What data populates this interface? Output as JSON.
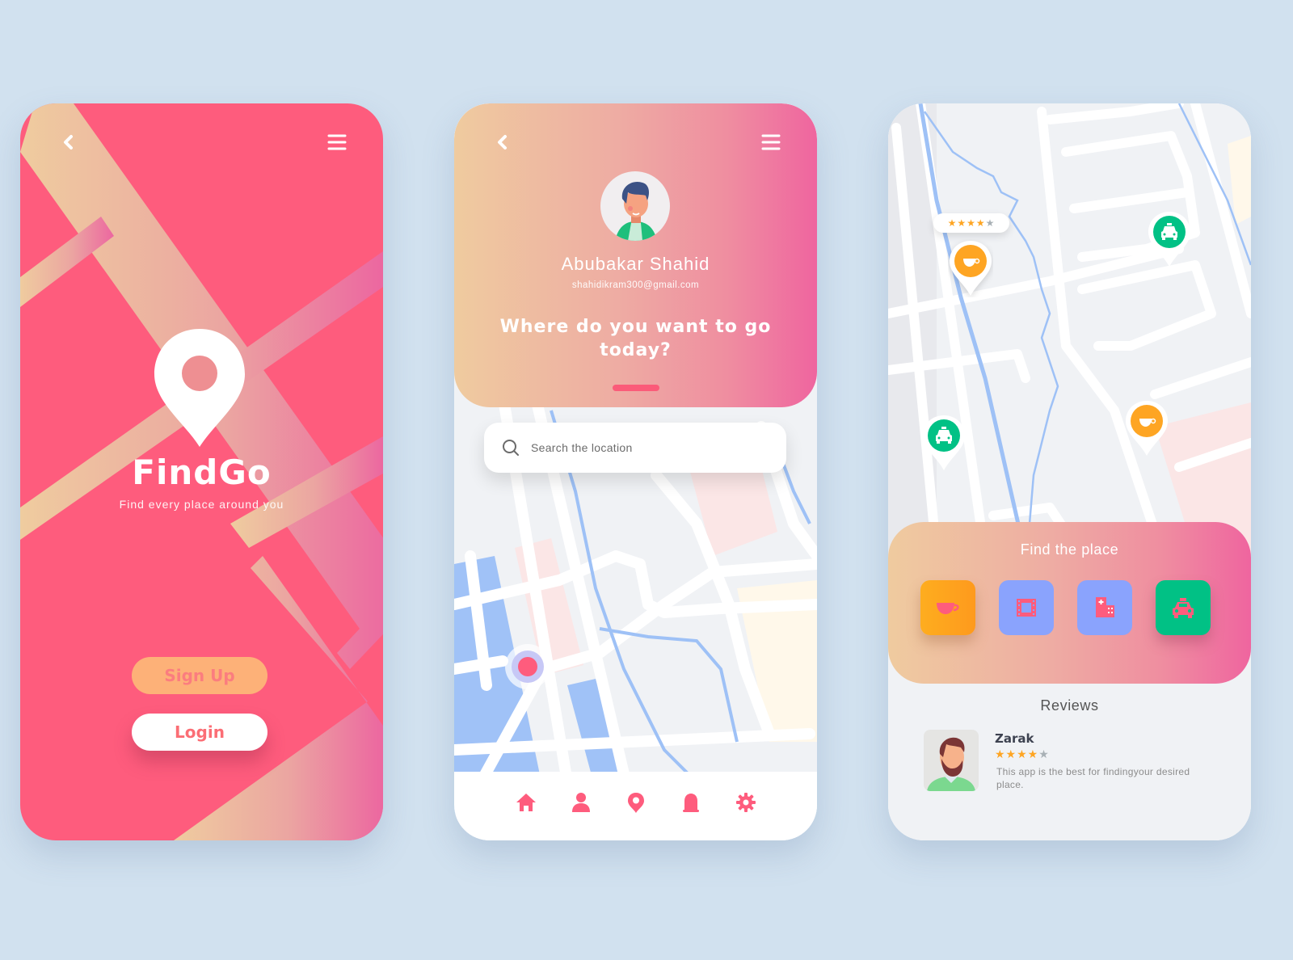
{
  "theme": {
    "background": "#d1e1ef",
    "brand_pink": "#fe5c7d",
    "gradient_start": "#efcb9f",
    "gradient_end": "#ef659f",
    "orange": "#fea523",
    "green": "#01c185",
    "periwinkle": "#8aa3fd",
    "map_water": "#a0c2f7",
    "map_land": "#f0f2f5"
  },
  "screen_welcome": {
    "back_icon": "chevron-left-icon",
    "menu_icon": "hamburger-menu-icon",
    "logo_icon": "location-pin-icon",
    "app_name": "FindGo",
    "tagline": "Find every place around you",
    "signup_label": "Sign Up",
    "login_label": "Login"
  },
  "screen_profile": {
    "back_icon": "chevron-left-icon",
    "menu_icon": "hamburger-menu-icon",
    "user_name": "Abubakar Shahid",
    "user_email": "shahidikram300@gmail.com",
    "question": "Where do you want to go today?",
    "search": {
      "placeholder": "Search the location",
      "value": ""
    },
    "nav": [
      {
        "name": "home",
        "icon": "home-icon"
      },
      {
        "name": "profile",
        "icon": "user-icon"
      },
      {
        "name": "location",
        "icon": "location-pin-icon"
      },
      {
        "name": "notifications",
        "icon": "bell-icon"
      },
      {
        "name": "settings",
        "icon": "gear-icon"
      }
    ]
  },
  "screen_explore": {
    "map_pins": [
      {
        "type": "cafe",
        "icon": "coffee-cup-icon",
        "rating": 4,
        "rating_max": 5
      },
      {
        "type": "taxi",
        "icon": "taxi-icon"
      },
      {
        "type": "taxi",
        "icon": "taxi-icon"
      },
      {
        "type": "cafe",
        "icon": "coffee-cup-icon"
      }
    ],
    "rating_stars": "★★★★",
    "rating_star_off": "★",
    "find_title": "Find the place",
    "categories": [
      {
        "name": "cafe",
        "icon": "coffee-cup-icon",
        "color": "#fea523"
      },
      {
        "name": "cinema",
        "icon": "film-icon",
        "color": "#8aa3fd"
      },
      {
        "name": "hospital",
        "icon": "hospital-building-icon",
        "color": "#8aa3fd"
      },
      {
        "name": "taxi",
        "icon": "taxi-icon",
        "color": "#01c185"
      }
    ],
    "reviews_title": "Reviews",
    "reviews": [
      {
        "author": "Zarak",
        "rating": 4,
        "rating_max": 5,
        "stars_on": "★★★★",
        "stars_off": "★",
        "text": "This app is the best for findingyour desired place."
      }
    ]
  }
}
